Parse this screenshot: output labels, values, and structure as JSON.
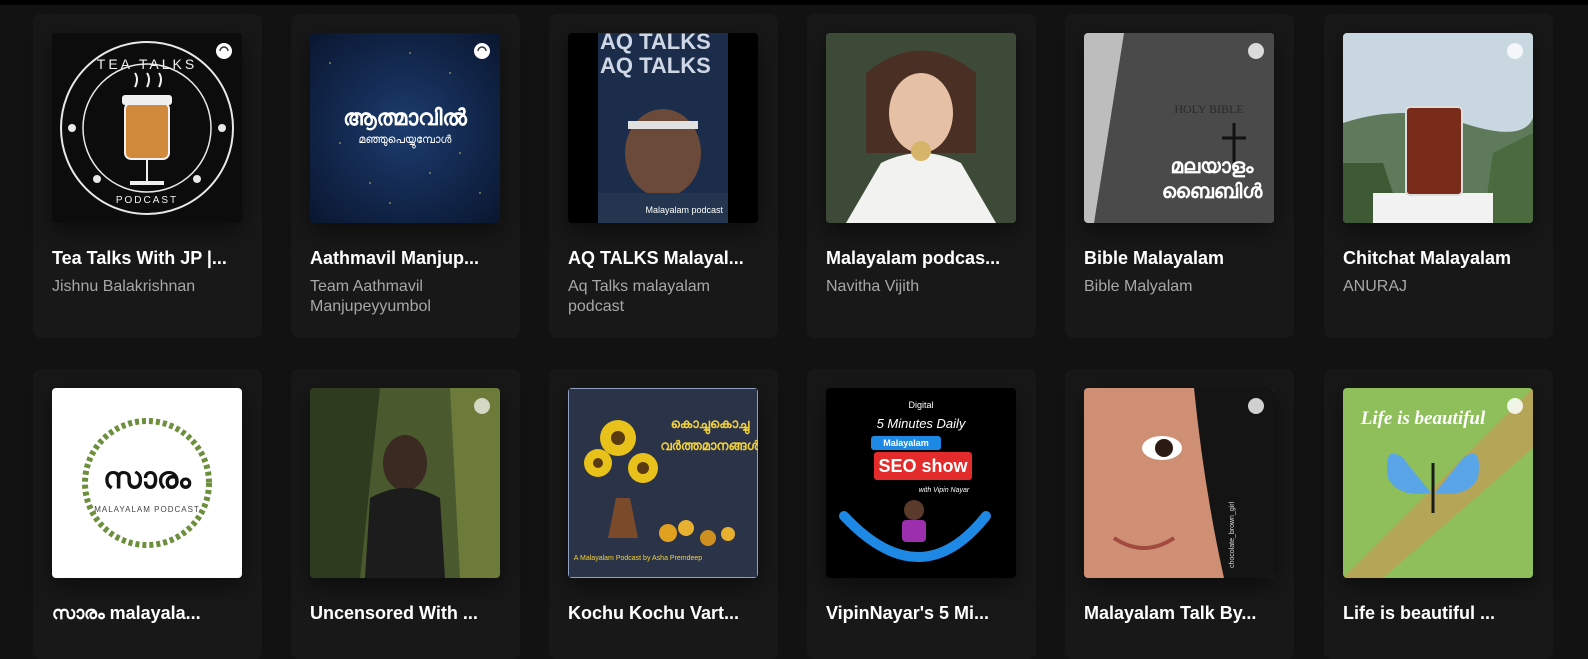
{
  "podcasts": [
    {
      "title": "Tea Talks With JP |...",
      "subtitle": "Jishnu Balakrishnan",
      "cover_text": "TEA TALKS",
      "cover_subtext": "PODCAST"
    },
    {
      "title": "Aathmavil Manjup...",
      "subtitle": "Team Aathmavil Manjupeyyumbol",
      "cover_text": "ആത്മാവിൽ",
      "cover_subtext": "മഞ്ഞുപെയ്യുമ്പോൾ"
    },
    {
      "title": "AQ TALKS Malayal...",
      "subtitle": "Aq Talks malayalam podcast",
      "cover_text": "AQ TALKS",
      "cover_subtext": "Malayalam podcast"
    },
    {
      "title": "Malayalam podcas...",
      "subtitle": "Navitha Vijith"
    },
    {
      "title": "Bible Malayalam",
      "subtitle": "Bible Malyalam",
      "cover_text": "മലയാളം",
      "cover_subtext": "ബൈബിൾ",
      "cover_book": "HOLY BIBLE"
    },
    {
      "title": "Chitchat Malayalam",
      "subtitle": "ANURAJ"
    },
    {
      "title": "സാരം malayala...",
      "subtitle": "",
      "cover_text": "സാരം",
      "cover_subtext": "MALAYALAM PODCAST"
    },
    {
      "title": "Uncensored With ...",
      "subtitle": ""
    },
    {
      "title": "Kochu Kochu Vart...",
      "subtitle": "",
      "cover_text": "കൊച്ചുകൊച്ചു",
      "cover_subtext": "വർത്തമാനങ്ങൾ",
      "cover_footer": "A Malayalam Podcast by Asha Premdeep"
    },
    {
      "title": "VipinNayar's 5 Mi...",
      "subtitle": "",
      "cover_text": "5 Minutes Daily",
      "cover_subtext": "SEO show",
      "cover_tag": "Malayalam",
      "cover_footer": "with Vipin Nayar",
      "cover_brand": "Digital"
    },
    {
      "title": "Malayalam Talk By...",
      "subtitle": "",
      "cover_footer": "chocolate_brown_girl"
    },
    {
      "title": "Life is beautiful ...",
      "subtitle": "",
      "cover_text": "Life is beautiful"
    }
  ]
}
